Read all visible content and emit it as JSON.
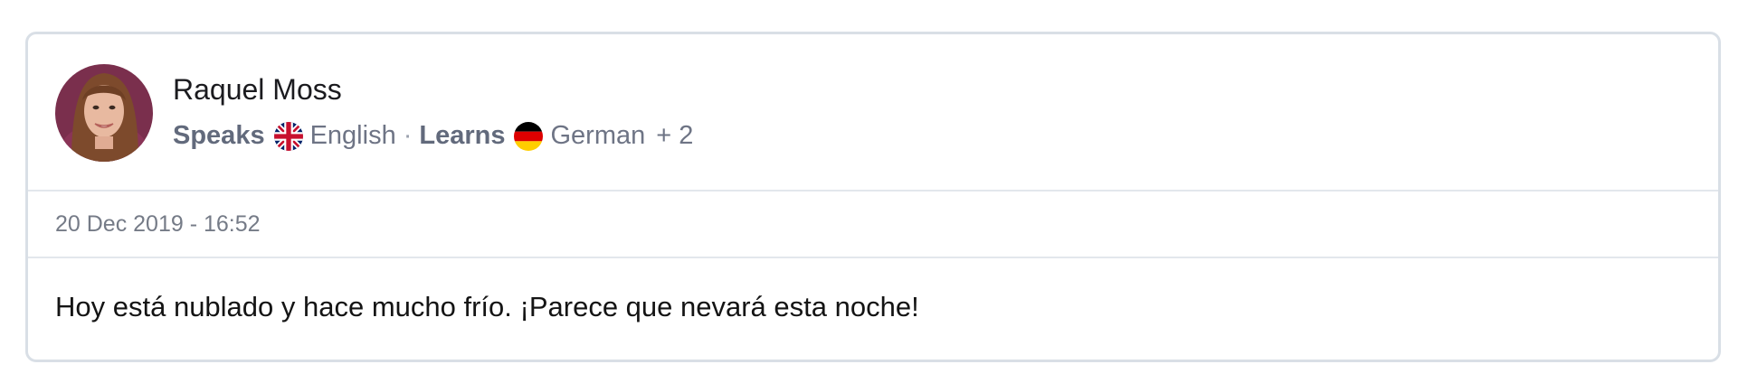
{
  "post": {
    "author": {
      "name": "Raquel Moss",
      "speaks_label": "Speaks",
      "native_language": "English",
      "native_flag": "uk-flag-icon",
      "separator": "·",
      "learns_label": "Learns",
      "learning_language": "German",
      "learning_flag": "germany-flag-icon",
      "more_languages": "+ 2"
    },
    "timestamp": "20 Dec 2019 - 16:52",
    "text": "Hoy está nublado y hace mucho frío. ¡Parece que nevará esta noche!"
  },
  "colors": {
    "border": "#d9dfe6",
    "divider": "#e3e7ec",
    "muted_text": "#6e7485",
    "body_text": "#141414"
  }
}
